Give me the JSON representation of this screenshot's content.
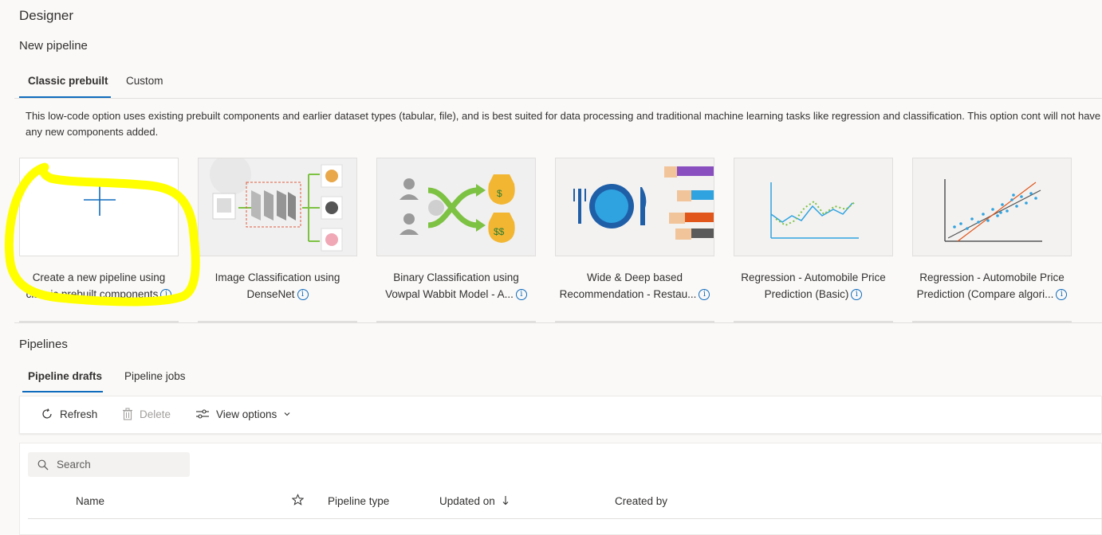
{
  "header": {
    "title": "Designer"
  },
  "new_pipeline": {
    "title": "New pipeline",
    "tabs": [
      {
        "label": "Classic prebuilt",
        "active": true
      },
      {
        "label": "Custom",
        "active": false
      }
    ],
    "description": "This low-code option uses existing prebuilt components and earlier dataset types (tabular, file), and is best suited for data processing and traditional machine learning tasks like regression and classification. This option cont will not have any new components added.",
    "cards": [
      {
        "line1": "Create a new pipeline using",
        "line2": "classic prebuilt components",
        "thumb_icon": "plus-icon"
      },
      {
        "line1": "Image Classification using",
        "line2": "DenseNet",
        "thumb_icon": "image-classification-illustration"
      },
      {
        "line1": "Binary Classification using",
        "line2": "Vowpal Wabbit Model - A...",
        "thumb_icon": "binary-classification-illustration"
      },
      {
        "line1": "Wide & Deep based",
        "line2": "Recommendation - Restau...",
        "thumb_icon": "recommendation-illustration"
      },
      {
        "line1": "Regression - Automobile Price",
        "line2": "Prediction (Basic)",
        "thumb_icon": "line-chart-illustration"
      },
      {
        "line1": "Regression - Automobile Price",
        "line2": "Prediction (Compare algori...",
        "thumb_icon": "scatter-chart-illustration"
      }
    ],
    "info_glyph": "i"
  },
  "pipelines": {
    "title": "Pipelines",
    "tabs": [
      {
        "label": "Pipeline drafts",
        "active": true
      },
      {
        "label": "Pipeline jobs",
        "active": false
      }
    ],
    "toolbar": {
      "refresh": "Refresh",
      "delete": "Delete",
      "view_options": "View options"
    },
    "search": {
      "placeholder": "Search",
      "value": ""
    },
    "columns": {
      "name": "Name",
      "favorite_icon": "star-icon",
      "pipeline_type": "Pipeline type",
      "updated_on": "Updated on",
      "created_by": "Created by"
    }
  },
  "colors": {
    "accent": "#0f6cbd",
    "highlight": "#ffff00",
    "background": "#faf9f8"
  }
}
